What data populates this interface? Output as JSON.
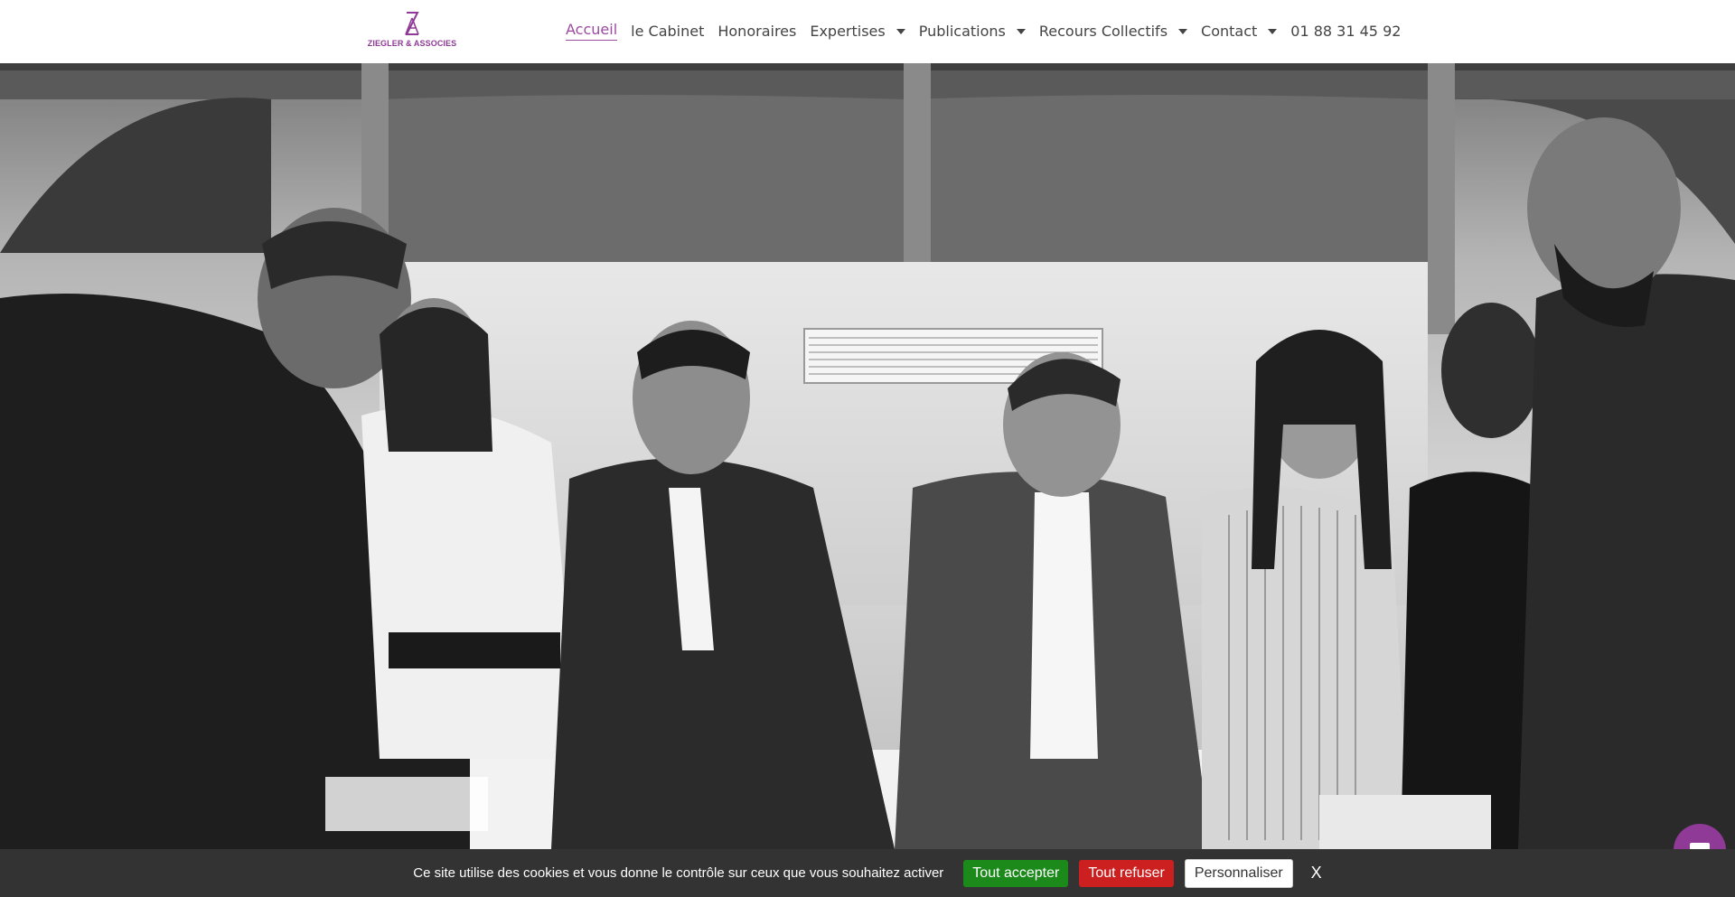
{
  "header": {
    "logo": {
      "text": "ZIEGLER & ASSOCIES",
      "color": "#8e3a96"
    },
    "nav": [
      {
        "label": "Accueil",
        "active": true,
        "dropdown": false
      },
      {
        "label": "le Cabinet",
        "active": false,
        "dropdown": false
      },
      {
        "label": "Honoraires",
        "active": false,
        "dropdown": false
      },
      {
        "label": "Expertises",
        "active": false,
        "dropdown": true
      },
      {
        "label": "Publications",
        "active": false,
        "dropdown": true
      },
      {
        "label": "Recours Collectifs",
        "active": false,
        "dropdown": true
      },
      {
        "label": "Contact",
        "active": false,
        "dropdown": true
      }
    ],
    "phone": "01 88 31 45 92"
  },
  "hero": {
    "image": "black-and-white team photo",
    "icon": "photo-icon"
  },
  "cookie_bar": {
    "message": "Ce site utilise des cookies et vous donne le contrôle sur ceux que vous souhaitez activer",
    "accept_label": "Tout accepter",
    "deny_label": "Tout refuser",
    "customize_label": "Personnaliser",
    "close_label": "X",
    "colors": {
      "background": "#333333",
      "accept": "#1b8a1b",
      "deny": "#cc1f1f"
    }
  },
  "chat": {
    "icon": "chat-icon",
    "color": "#8e3a96"
  }
}
